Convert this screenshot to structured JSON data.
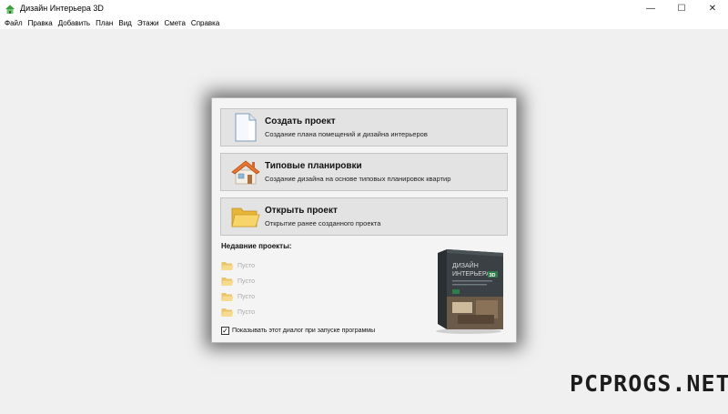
{
  "window": {
    "title": "Дизайн Интерьера 3D",
    "controls": {
      "minimize": "—",
      "maximize": "☐",
      "close": "✕"
    }
  },
  "menu": [
    "Файл",
    "Правка",
    "Добавить",
    "План",
    "Вид",
    "Этажи",
    "Смета",
    "Справка"
  ],
  "dialog": {
    "actions": [
      {
        "title": "Создать проект",
        "subtitle": "Создание плана помещений и дизайна интерьеров",
        "icon": "document-icon"
      },
      {
        "title": "Типовые планировки",
        "subtitle": "Создание дизайна на основе типовых планировок квартир",
        "icon": "house-icon"
      },
      {
        "title": "Открыть проект",
        "subtitle": "Открытие ранее созданного проекта",
        "icon": "folder-icon"
      }
    ],
    "recent_title": "Недавние проекты:",
    "recent_items": [
      "Пусто",
      "Пусто",
      "Пусто",
      "Пусто"
    ],
    "show_on_start": {
      "checked": true,
      "label": "Показывать этот диалог при запуске программы"
    },
    "product_box": {
      "title_line1": "ДИЗАЙН",
      "title_line2": "ИНТЕРЬЕРА",
      "badge": "3D"
    }
  },
  "watermark": "PCPROGS.NET"
}
